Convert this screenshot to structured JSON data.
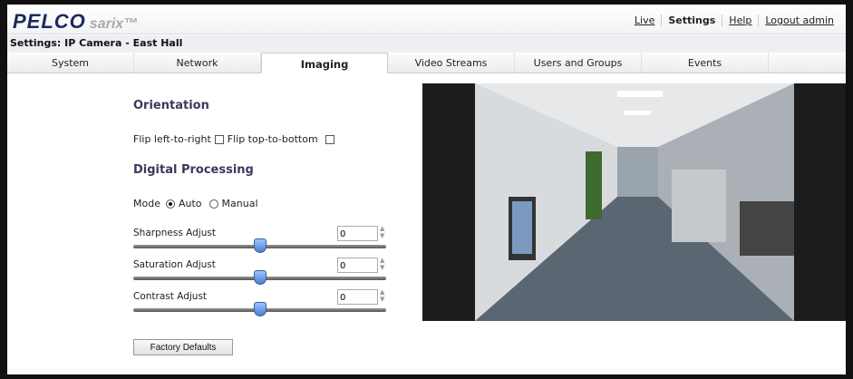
{
  "brand": {
    "logo": "PELCO",
    "product": "sarix™"
  },
  "topnav": [
    {
      "label": "Live"
    },
    {
      "label": "Settings",
      "current": true
    },
    {
      "label": "Help"
    },
    {
      "label": "Logout admin"
    }
  ],
  "subtitle": "Settings: IP Camera - East Hall",
  "tabs": [
    {
      "label": "System"
    },
    {
      "label": "Network"
    },
    {
      "label": "Imaging",
      "active": true
    },
    {
      "label": "Video Streams"
    },
    {
      "label": "Users and Groups"
    },
    {
      "label": "Events"
    }
  ],
  "orientation": {
    "heading": "Orientation",
    "flip_lr_label": "Flip left-to-right",
    "flip_lr": false,
    "flip_tb_label": "Flip top-to-bottom",
    "flip_tb": false
  },
  "digital": {
    "heading": "Digital Processing",
    "mode_label": "Mode",
    "mode_auto": "Auto",
    "mode_manual": "Manual",
    "mode": "Auto"
  },
  "adjustments": [
    {
      "label": "Sharpness Adjust",
      "value": "0",
      "slider_fraction": 0.5
    },
    {
      "label": "Saturation Adjust",
      "value": "0",
      "slider_fraction": 0.5
    },
    {
      "label": "Contrast Adjust",
      "value": "0",
      "slider_fraction": 0.5
    }
  ],
  "factory_button": "Factory Defaults"
}
